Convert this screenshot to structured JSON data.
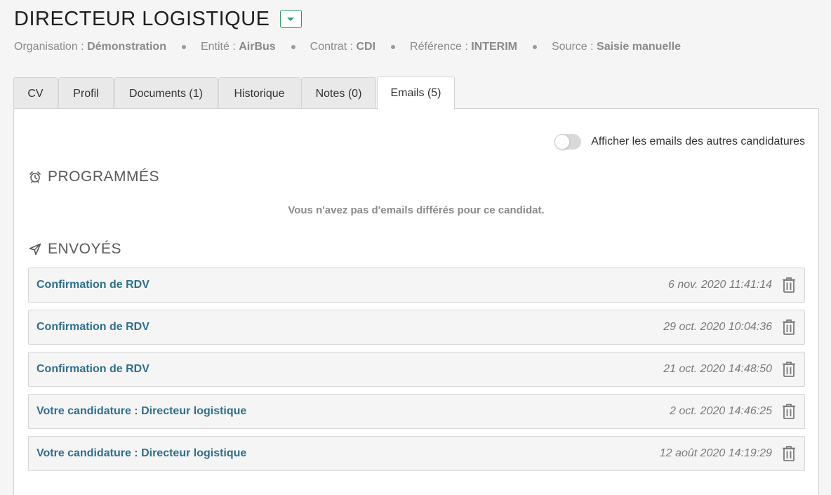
{
  "header": {
    "title": "DIRECTEUR LOGISTIQUE",
    "meta": [
      {
        "label": "Organisation : ",
        "value": "Démonstration"
      },
      {
        "label": "Entité : ",
        "value": "AirBus"
      },
      {
        "label": "Contrat : ",
        "value": "CDI"
      },
      {
        "label": "Référence : ",
        "value": "INTERIM"
      },
      {
        "label": "Source : ",
        "value": "Saisie manuelle"
      }
    ]
  },
  "tabs": [
    {
      "label": "CV"
    },
    {
      "label": "Profil"
    },
    {
      "label": "Documents (1)"
    },
    {
      "label": "Historique"
    },
    {
      "label": "Notes (0)"
    },
    {
      "label": "Emails (5)",
      "active": true
    }
  ],
  "emails_panel": {
    "toggle_label": "Afficher les emails des autres candidatures",
    "toggle_on": false,
    "scheduled_title": "PROGRAMMÉS",
    "scheduled_empty": "Vous n'avez pas d'emails différés pour ce candidat.",
    "sent_title": "ENVOYÉS",
    "sent": [
      {
        "subject": "Confirmation de RDV",
        "date": "6 nov. 2020 11:41:14"
      },
      {
        "subject": "Confirmation de RDV",
        "date": "29 oct. 2020 10:04:36"
      },
      {
        "subject": "Confirmation de RDV",
        "date": "21 oct. 2020 14:48:50"
      },
      {
        "subject": "Votre candidature : Directeur logistique",
        "date": "2 oct. 2020 14:46:25"
      },
      {
        "subject": "Votre candidature : Directeur logistique",
        "date": "12 août 2020 14:19:29"
      }
    ]
  },
  "icons": {
    "scheduled": "alarm-clock-icon",
    "sent": "paper-plane-icon",
    "delete": "trash-icon",
    "dropdown": "caret-down-icon"
  },
  "colors": {
    "accent_green": "#2e9c6a",
    "link_blue": "#2f6f8c"
  }
}
